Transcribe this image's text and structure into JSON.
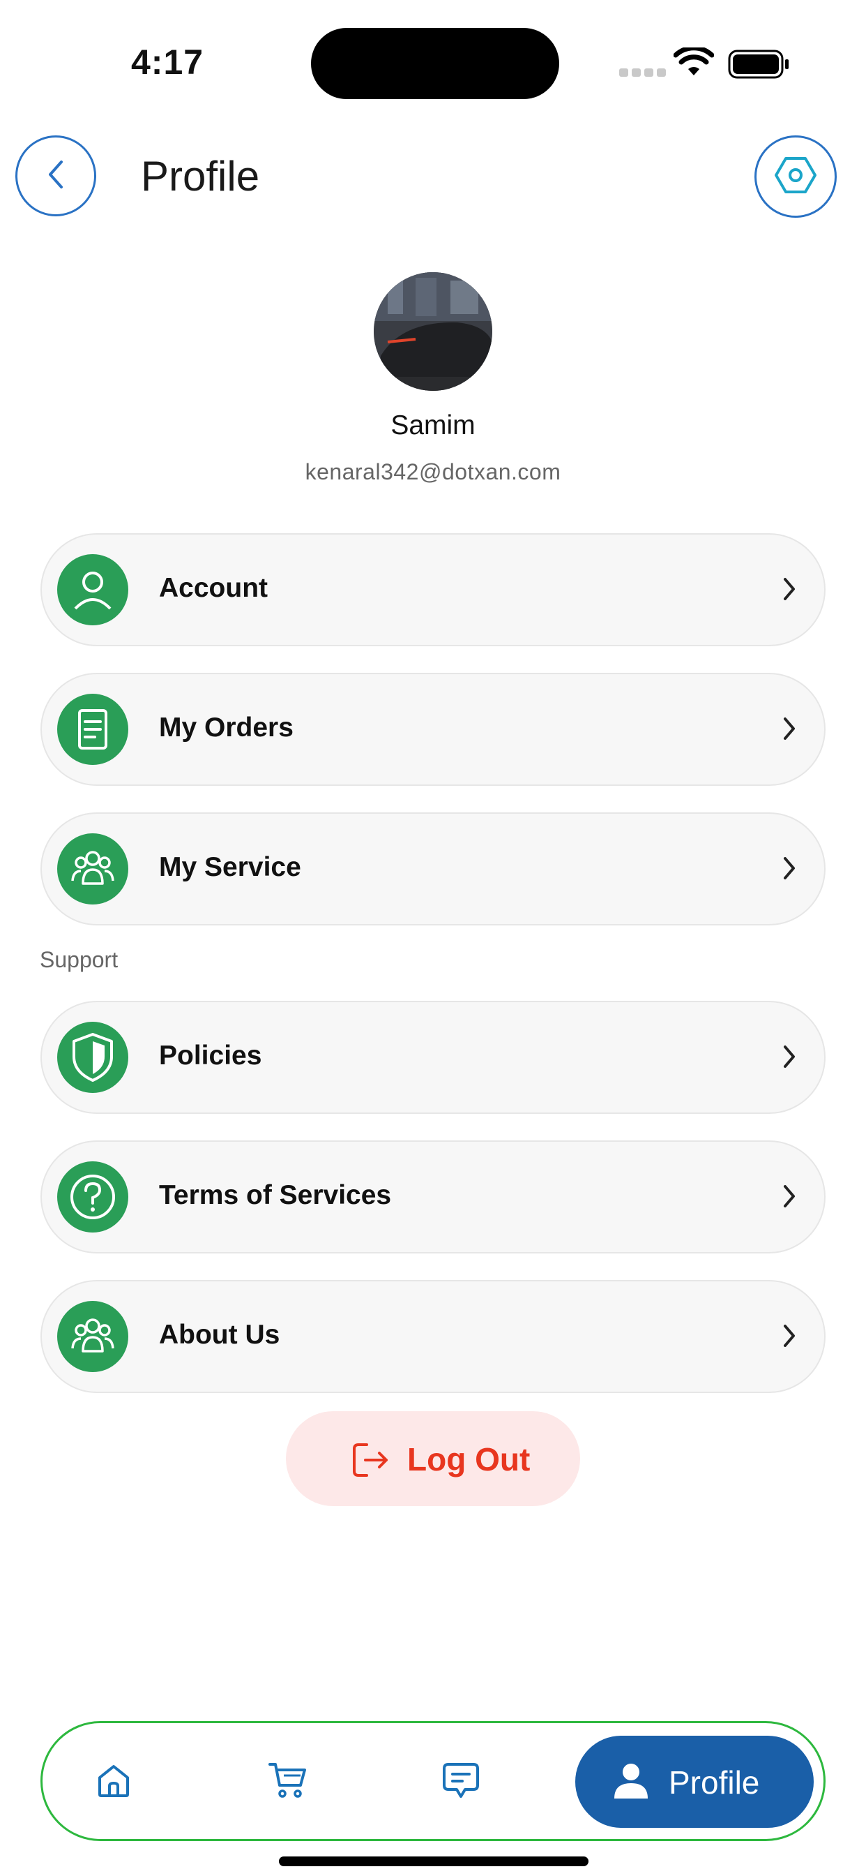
{
  "status_bar": {
    "time": "4:17"
  },
  "header": {
    "title": "Profile"
  },
  "profile": {
    "name": "Samim",
    "email": "kenaral342@dotxan.com"
  },
  "menu": [
    {
      "label": "Account",
      "icon": "person-icon"
    },
    {
      "label": "My Orders",
      "icon": "document-list-icon"
    },
    {
      "label": "My Service",
      "icon": "group-icon"
    }
  ],
  "support": {
    "section_label": "Support",
    "items": [
      {
        "label": "Policies",
        "icon": "shield-icon"
      },
      {
        "label": "Terms of Services",
        "icon": "question-circle-icon"
      },
      {
        "label": "About Us",
        "icon": "group-icon"
      }
    ]
  },
  "logout": {
    "label": "Log Out"
  },
  "bottom_nav": {
    "items": [
      {
        "icon": "home-icon"
      },
      {
        "icon": "cart-icon"
      },
      {
        "icon": "chat-icon"
      }
    ],
    "active": {
      "label": "Profile",
      "icon": "person-icon"
    }
  },
  "colors": {
    "primary_blue": "#1a5fa8",
    "menu_icon_green": "#2a9e57",
    "nav_border_green": "#2db83e",
    "logout_red": "#e8361f",
    "logout_bg": "#fde8e8"
  }
}
